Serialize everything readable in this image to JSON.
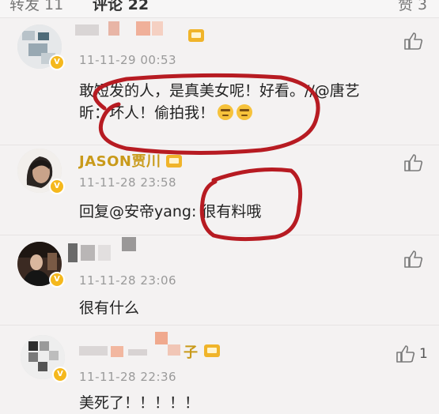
{
  "tabs": {
    "repost": "转发 11",
    "comments": "评论 22",
    "likes": "赞 3"
  },
  "comments": [
    {
      "name": "",
      "time": "11-11-29 00:53",
      "text_line1": "敢短发的人，是真美女呢！好看。//@唐艺",
      "text_line2": "昕：坏人！偷拍我！",
      "emoji": [
        "cool-emoji",
        "cool-emoji"
      ],
      "verified": true
    },
    {
      "name": "JASON贾川",
      "time": "11-11-28 23:58",
      "text": "回复@安帝yang: 很有料哦",
      "verified": true
    },
    {
      "name": "",
      "time": "11-11-28 23:06",
      "text": "很有什么",
      "verified": true
    },
    {
      "name": "子",
      "time": "11-11-28 22:36",
      "text": "美死了！！！！！",
      "verified": true,
      "like_count": "1"
    }
  ],
  "colors": {
    "name_gold": "#c99a1a",
    "annotation_red": "#b71b22",
    "vip_badge": "#f0b42a"
  }
}
